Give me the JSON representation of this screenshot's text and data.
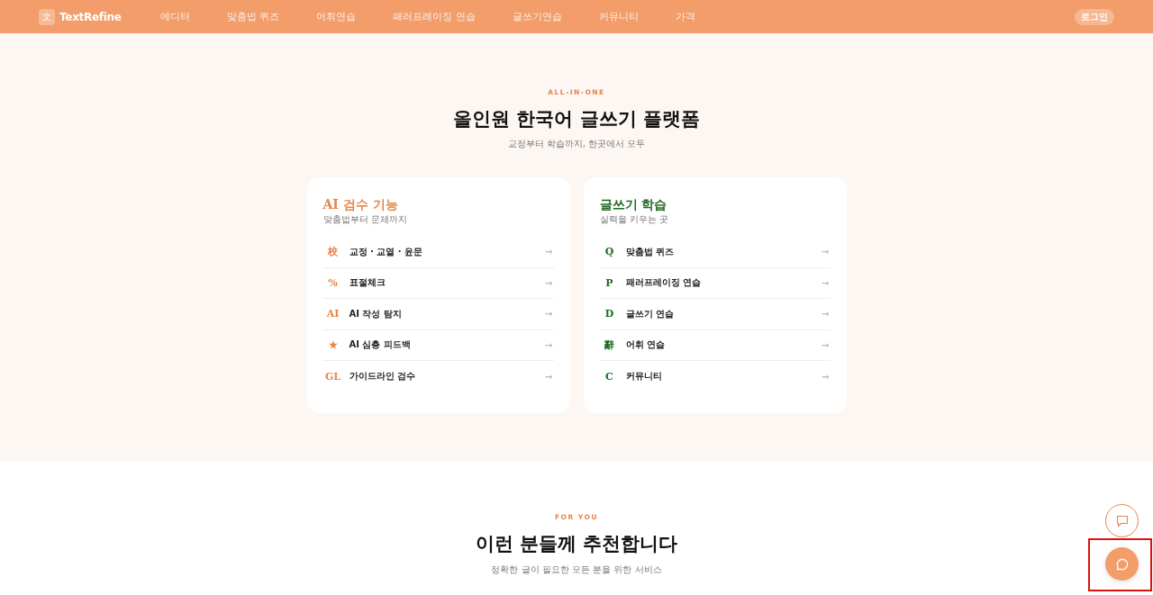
{
  "nav": {
    "logo_mark": "文",
    "brand": "TextRefine",
    "links": [
      "에디터",
      "맞춤법 퀴즈",
      "어휘연습",
      "패러프레이징 연습",
      "글쓰기연습",
      "커뮤니티",
      "가격"
    ],
    "login": "로그인"
  },
  "hero": {
    "eyebrow": "ALL-IN-ONE",
    "title": "올인원 한국어 글쓰기 플랫폼",
    "subtitle": "교정부터 학습까지, 한곳에서 모두",
    "cards": [
      {
        "title": "AI 검수 기능",
        "subtitle": "맞춤법부터 문체까지",
        "color": "#e8844a",
        "items": [
          {
            "mark": "校",
            "label": "교정 · 교열 · 윤문",
            "arrow": "→"
          },
          {
            "mark": "%",
            "label": "표절체크",
            "arrow": "→"
          },
          {
            "mark": "AI",
            "label": "AI 작성 탐지",
            "arrow": "→"
          },
          {
            "mark": "★",
            "label": "AI 심층 피드백",
            "arrow": "→"
          },
          {
            "mark": "GL",
            "label": "가이드라인 검수",
            "arrow": "→"
          }
        ]
      },
      {
        "title": "글쓰기 학습",
        "subtitle": "실력을 키우는 곳",
        "color": "#1f6b22",
        "items": [
          {
            "mark": "Q",
            "label": "맞춤법 퀴즈",
            "arrow": "→"
          },
          {
            "mark": "P",
            "label": "패러프레이징 연습",
            "arrow": "→"
          },
          {
            "mark": "D",
            "label": "글쓰기 연습",
            "arrow": "→"
          },
          {
            "mark": "辭",
            "label": "어휘 연습",
            "arrow": "→"
          },
          {
            "mark": "C",
            "label": "커뮤니티",
            "arrow": "→"
          }
        ]
      }
    ]
  },
  "for_you": {
    "eyebrow": "FOR YOU",
    "title": "이런 분들께 추천합니다",
    "subtitle": "정확한 글이 필요한 모든 분을 위한 서비스"
  },
  "floating_buttons": [
    {
      "kind": "outline",
      "highlighted": false
    },
    {
      "kind": "filled",
      "highlighted": true
    }
  ]
}
